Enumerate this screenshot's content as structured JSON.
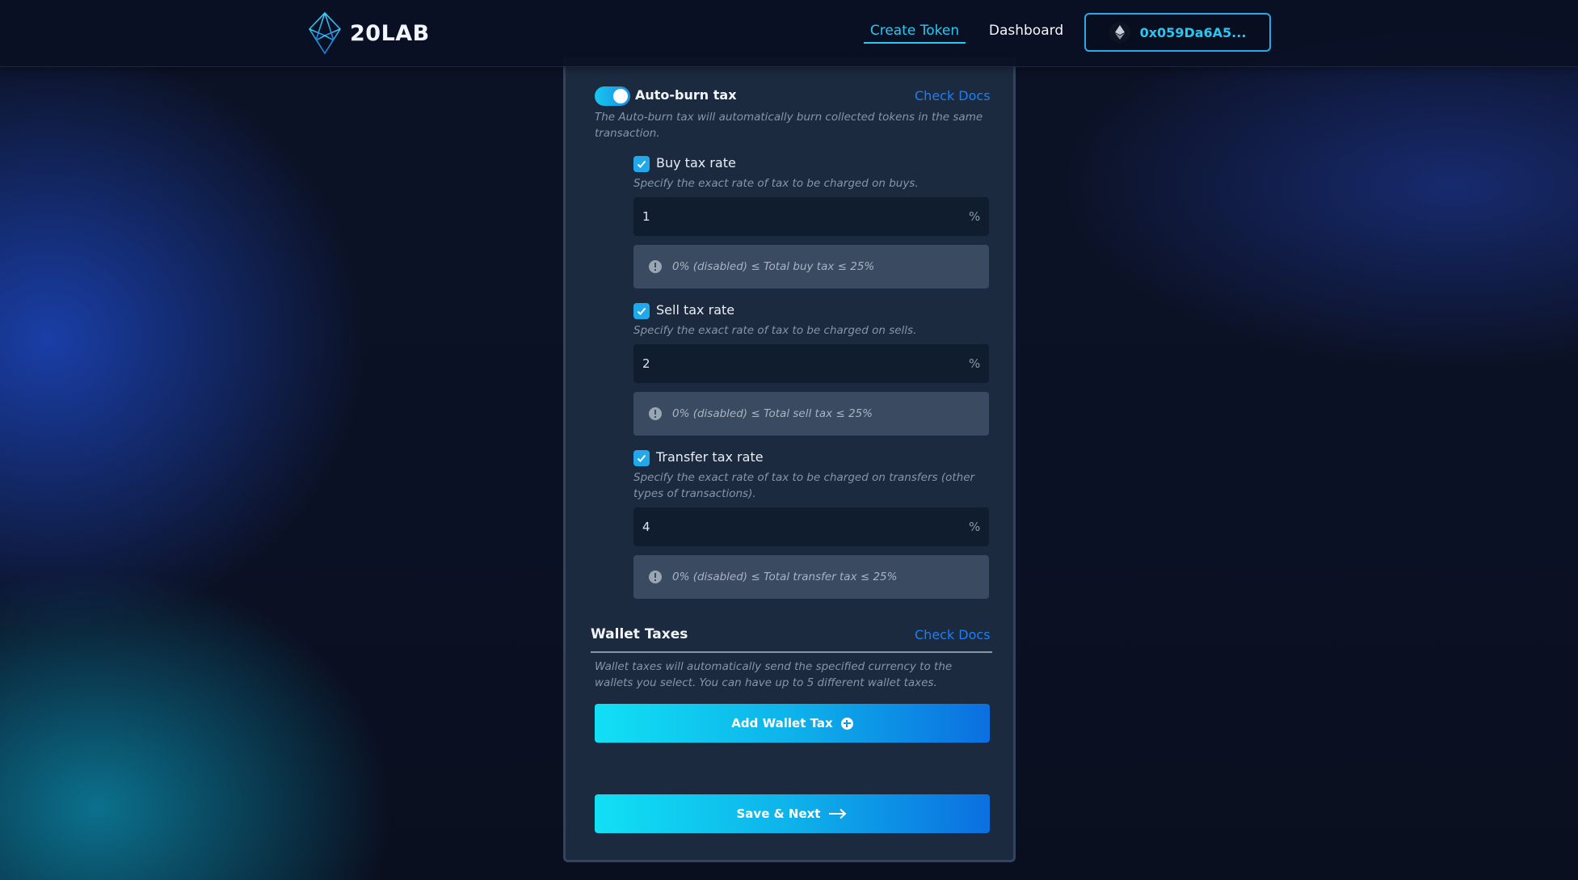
{
  "header": {
    "logo_text": "20LAB",
    "nav": {
      "create_token": "Create Token",
      "dashboard": "Dashboard"
    },
    "wallet_address": "0x059Da6A5..."
  },
  "auto_burn": {
    "enabled": true,
    "label": "Auto-burn tax",
    "docs_link": "Check Docs",
    "description": "The Auto-burn tax will automatically burn collected tokens in the same transaction.",
    "taxes": [
      {
        "label": "Buy tax rate",
        "checked": true,
        "description": "Specify the exact rate of tax to be charged on buys.",
        "value": "1",
        "unit": "%",
        "hint": "0% (disabled) ≤ Total buy tax ≤ 25%"
      },
      {
        "label": "Sell tax rate",
        "checked": true,
        "description": "Specify the exact rate of tax to be charged on sells.",
        "value": "2",
        "unit": "%",
        "hint": "0% (disabled) ≤ Total sell tax ≤ 25%"
      },
      {
        "label": "Transfer tax rate",
        "checked": true,
        "description": "Specify the exact rate of tax to be charged on transfers (other types of transactions).",
        "value": "4",
        "unit": "%",
        "hint": "0% (disabled) ≤ Total transfer tax ≤ 25%"
      }
    ]
  },
  "wallet_taxes": {
    "title": "Wallet Taxes",
    "docs_link": "Check Docs",
    "description": "Wallet taxes will automatically send the specified currency to the wallets you select. You can have up to 5 different wallet taxes.",
    "add_button": "Add Wallet Tax"
  },
  "footer": {
    "save_button": "Save & Next"
  },
  "colors": {
    "accent": "#29c8f0",
    "link": "#1f7ff0",
    "card": "#1c2a40",
    "checkbox": "#20a8ea"
  }
}
